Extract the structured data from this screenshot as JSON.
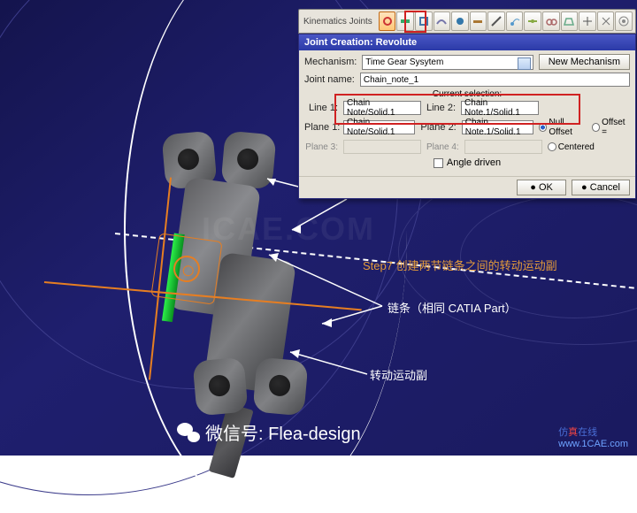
{
  "toolbar": {
    "title": "Kinematics Joints"
  },
  "dialog": {
    "title": "Joint Creation: Revolute",
    "mechanism_label": "Mechanism:",
    "mechanism_value": "Time Gear Sysytem",
    "new_mech": "New Mechanism",
    "jointname_label": "Joint name:",
    "jointname_value": "Chain_note_1",
    "cur_sel": "Current selection:",
    "line1_label": "Line 1:",
    "line1_value": "Chain Note/Solid.1",
    "line2_label": "Line 2:",
    "line2_value": "Chain Note.1/Solid.1",
    "plane1_label": "Plane 1:",
    "plane1_value": "Chain Note/Solid.1",
    "plane2_label": "Plane 2:",
    "plane2_value": "Chain Note.1/Solid.1",
    "null_offset": "Null Offset",
    "offset": "Offset =",
    "offset_val": "",
    "plane3_label": "Plane 3:",
    "plane4_label": "Plane 4:",
    "centered": "Centered",
    "angle_driven": "Angle driven",
    "ok": "OK",
    "cancel": "Cancel"
  },
  "anno": {
    "step": "Step7 创建两节链条之间的转动运动副",
    "chain": "链条（相同 CATIA Part）",
    "joint": "转动运动副"
  },
  "wechat": "微信号: Flea-design",
  "wm": {
    "site": "www.1CAE.com",
    "pre": "仿",
    "seg1": "真",
    "seg2": "在线"
  }
}
